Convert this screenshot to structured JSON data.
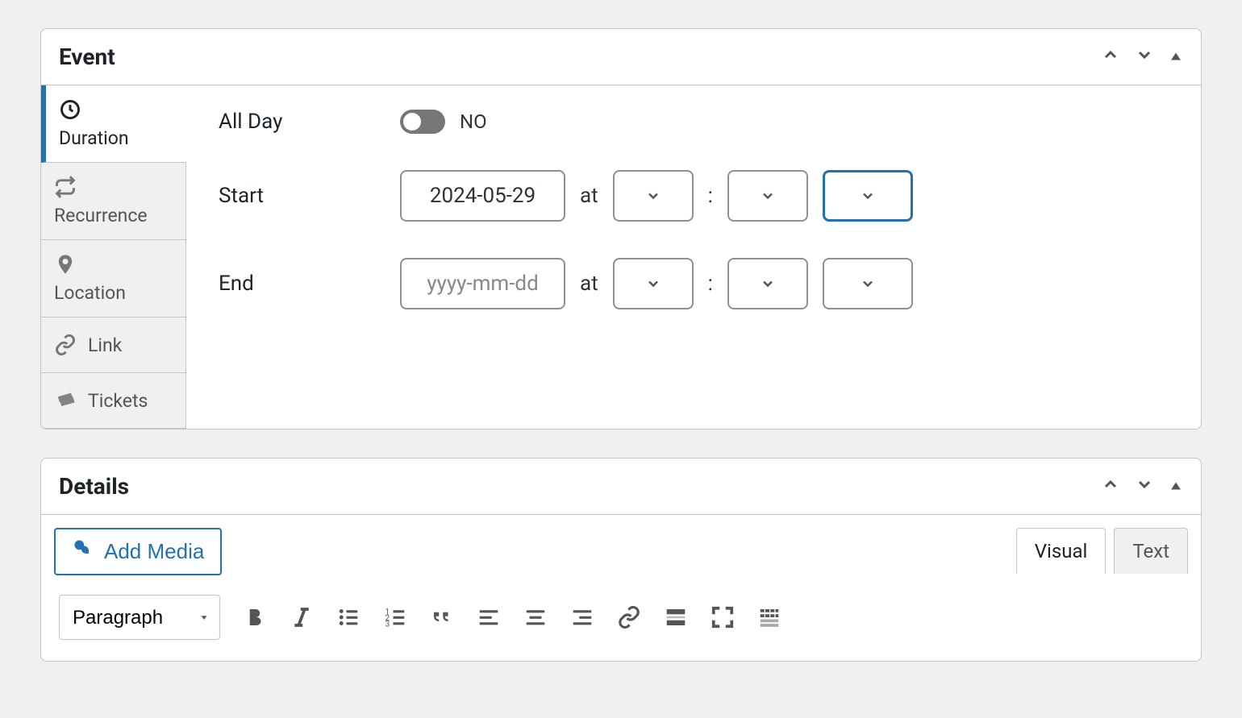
{
  "event_panel": {
    "title": "Event",
    "tabs": [
      {
        "label": "Duration",
        "icon": "clock"
      },
      {
        "label": "Recurrence",
        "icon": "repeat"
      },
      {
        "label": "Location",
        "icon": "location"
      },
      {
        "label": "Link",
        "icon": "link"
      },
      {
        "label": "Tickets",
        "icon": "tickets"
      }
    ],
    "allday": {
      "label": "All Day",
      "state": "NO"
    },
    "start": {
      "label": "Start",
      "date": "2024-05-29",
      "at": "at",
      "colon": ":"
    },
    "end": {
      "label": "End",
      "placeholder": "yyyy-mm-dd",
      "at": "at",
      "colon": ":"
    }
  },
  "details_panel": {
    "title": "Details",
    "add_media": "Add Media",
    "editor_tabs": {
      "visual": "Visual",
      "text": "Text"
    },
    "format": "Paragraph"
  }
}
